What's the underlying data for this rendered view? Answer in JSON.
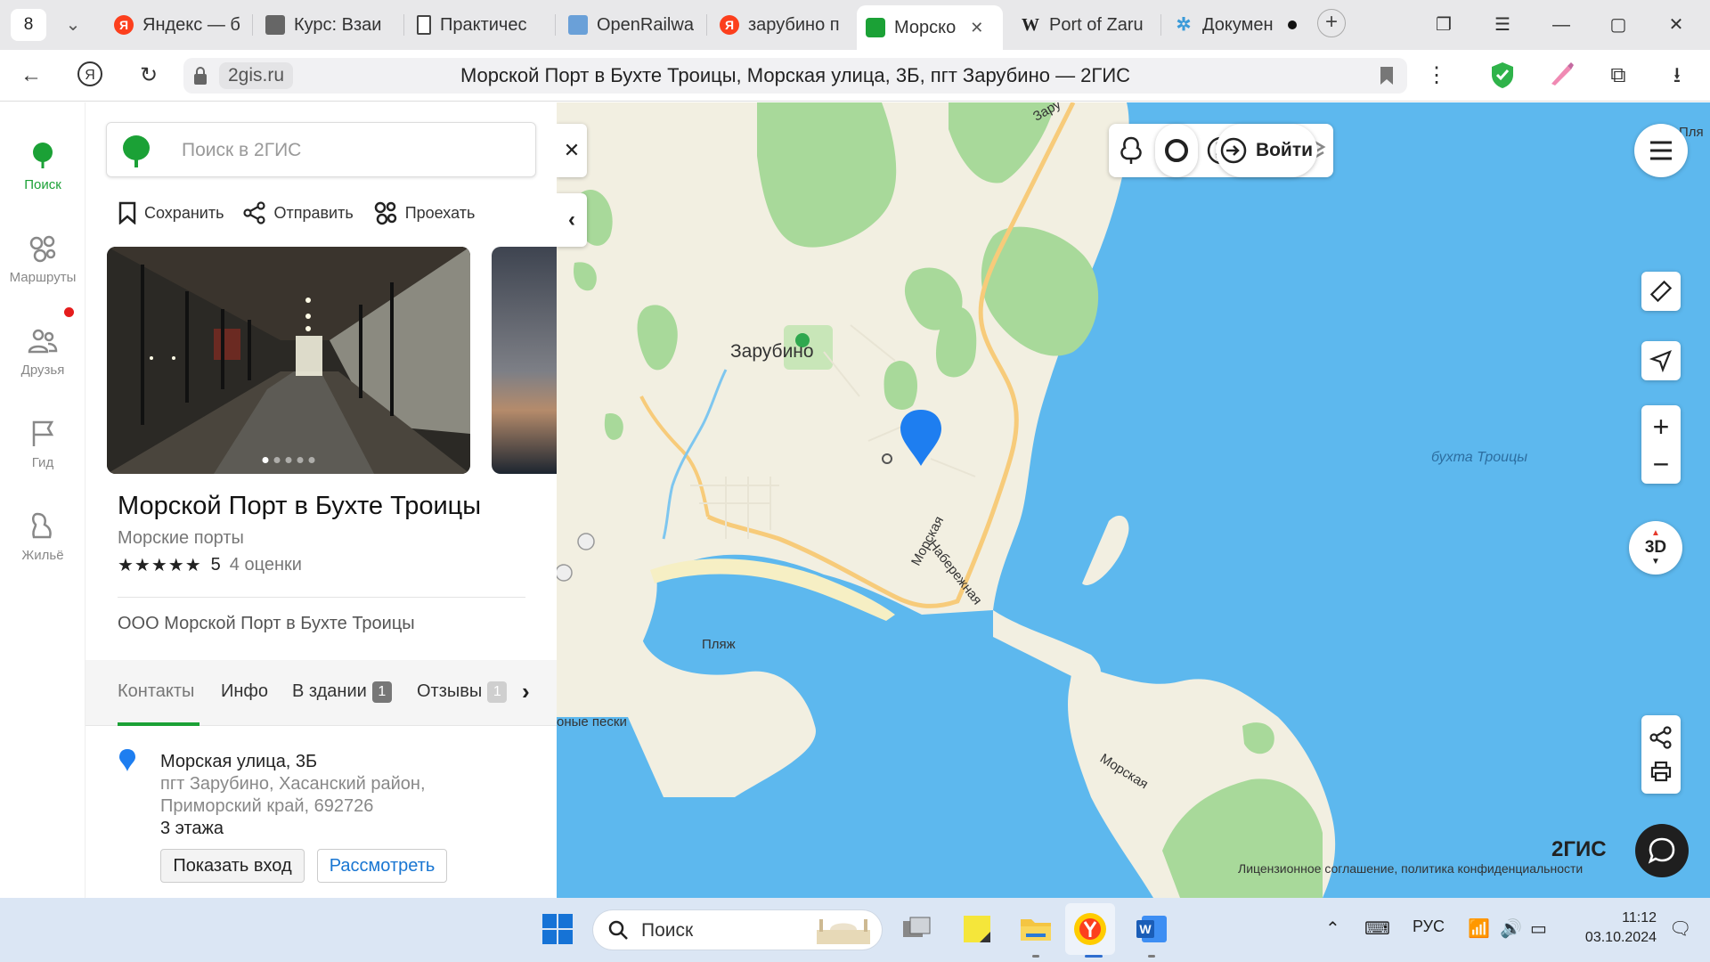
{
  "browser": {
    "tab_count": "8",
    "tabs": [
      {
        "label": "Яндекс — б",
        "icon": "yandex-icon"
      },
      {
        "label": "Курс: Взаи",
        "icon": "course-icon"
      },
      {
        "label": "Практичес",
        "icon": "document-icon"
      },
      {
        "label": "OpenRailwa",
        "icon": "openrailway-icon"
      },
      {
        "label": "зарубино п",
        "icon": "yandex-icon"
      },
      {
        "label": "Морско",
        "icon": "2gis-icon"
      },
      {
        "label": "Port of Zaru",
        "icon": "wikipedia-icon"
      },
      {
        "label": "Докумен",
        "icon": "gear-icon"
      }
    ],
    "domain": "2gis.ru",
    "page_title": "Морской Порт в Бухте Троицы, Морская улица, 3Б, пгт Зарубино — 2ГИС"
  },
  "rail": {
    "items": [
      {
        "label": "Поиск"
      },
      {
        "label": "Маршруты"
      },
      {
        "label": "Друзья"
      },
      {
        "label": "Гид"
      },
      {
        "label": "Жильё"
      }
    ]
  },
  "panel": {
    "search_placeholder": "Поиск в 2ГИС",
    "actions": {
      "save": "Сохранить",
      "send": "Отправить",
      "route": "Проехать"
    },
    "title": "Морской Порт в Бухте Троицы",
    "category": "Морские порты",
    "stars": "★★★★★",
    "rating": "5",
    "reviews": "4 оценки",
    "org": "ООО Морской Порт в Бухте Троицы",
    "tabs": {
      "contacts": "Контакты",
      "info": "Инфо",
      "building": "В здании",
      "building_count": "1",
      "reviews": "Отзывы",
      "reviews_count": "1"
    },
    "address": {
      "line1": "Морская улица, 3Б",
      "line2": "пгт Зарубино, Хасанский район,",
      "line3": "Приморский край, 692726",
      "floors": "3 этажа"
    },
    "buttons": {
      "entrance": "Показать вход",
      "view": "Рассмотреть"
    }
  },
  "map": {
    "login": "Войти",
    "three_d": "3D",
    "labels": {
      "town": "Зарубино",
      "bay": "бухта Троицы",
      "beach": "Пляж",
      "sands": "оные пески",
      "street_morskaya": "Морская",
      "street_naberezhnaya": "Набережная",
      "street_morskaya2": "Морская",
      "top_road": "Зару",
      "top_right": "Пля"
    },
    "logo": "2ГИС",
    "license": "Лицензионное соглашение, политика конфиденциальности"
  },
  "taskbar": {
    "search": "Поиск",
    "lang": "РУС",
    "time": "11:12",
    "date": "03.10.2024"
  },
  "colors": {
    "brand_green": "#1ba136",
    "water": "#5db8ee",
    "land": "#f2efe1",
    "forest": "#a8d99a",
    "pin": "#1e7ef0"
  }
}
